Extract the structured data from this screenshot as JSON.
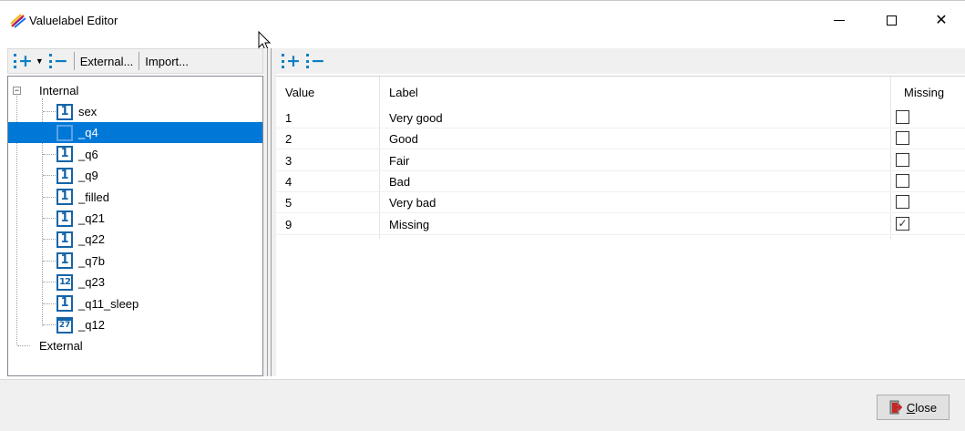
{
  "window": {
    "title": "Valuelabel Editor",
    "controls": {
      "minimize": "minimize-icon",
      "maximize": "maximize-icon",
      "close": "close-icon"
    }
  },
  "left_toolbar": {
    "add_icon": "add-icon",
    "dropdown_icon": "chevron-down-icon",
    "remove_icon": "remove-icon",
    "external_label": "External...",
    "import_label": "Import..."
  },
  "right_toolbar": {
    "add_icon": "add-row-icon",
    "remove_icon": "remove-row-icon"
  },
  "tree": {
    "root_internal": "Internal",
    "root_external": "External",
    "items": [
      {
        "label": "sex",
        "icon": "1",
        "selected": false
      },
      {
        "label": "_q4",
        "icon": "1",
        "selected": true
      },
      {
        "label": "_q6",
        "icon": "1",
        "selected": false
      },
      {
        "label": "_q9",
        "icon": "1",
        "selected": false
      },
      {
        "label": "_filled",
        "icon": "1",
        "selected": false
      },
      {
        "label": "_q21",
        "icon": "1",
        "selected": false
      },
      {
        "label": "_q22",
        "icon": "1",
        "selected": false
      },
      {
        "label": "_q7b",
        "icon": "1",
        "selected": false
      },
      {
        "label": "_q23",
        "icon": "12",
        "selected": false
      },
      {
        "label": "_q11_sleep",
        "icon": "1",
        "selected": false
      },
      {
        "label": "_q12",
        "icon": "27",
        "selected": false
      }
    ]
  },
  "grid": {
    "headers": {
      "value": "Value",
      "label": "Label",
      "missing": "Missing"
    },
    "rows": [
      {
        "value": "1",
        "label": "Very good",
        "missing": false
      },
      {
        "value": "2",
        "label": "Good",
        "missing": false
      },
      {
        "value": "3",
        "label": "Fair",
        "missing": false
      },
      {
        "value": "4",
        "label": "Bad",
        "missing": false
      },
      {
        "value": "5",
        "label": "Very bad",
        "missing": false
      },
      {
        "value": "9",
        "label": "Missing",
        "missing": true
      }
    ]
  },
  "footer": {
    "close_prefix": "C",
    "close_rest": "lose"
  },
  "colors": {
    "accent": "#0078d7",
    "icon_blue": "#1464a8",
    "toolbar_blue": "#0b7fc1"
  }
}
